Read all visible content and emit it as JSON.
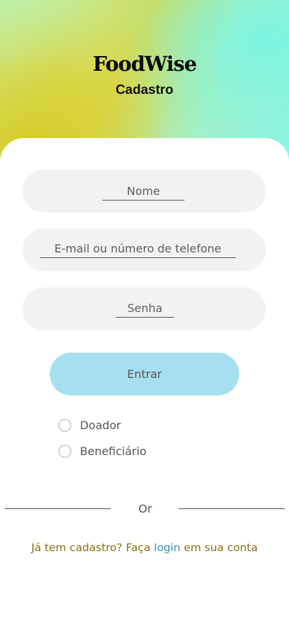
{
  "header": {
    "app_name": "FoodWise",
    "subtitle": "Cadastro"
  },
  "form": {
    "name_placeholder": "Nome",
    "contact_placeholder": "E-mail ou número de telefone",
    "password_placeholder": "Senha",
    "submit_label": "Entrar"
  },
  "role": {
    "options": [
      {
        "label": "Doador",
        "selected": false
      },
      {
        "label": "Beneficiário",
        "selected": false
      }
    ]
  },
  "divider": {
    "text": "Or"
  },
  "footer": {
    "prefix": "Já tem cadastro? Faça ",
    "link": "login",
    "suffix": " em sua conta"
  },
  "colors": {
    "button": "#a6dff0",
    "link": "#3c91b4",
    "footer_text": "#8a6d14",
    "field_bg": "#f2f2f2"
  }
}
